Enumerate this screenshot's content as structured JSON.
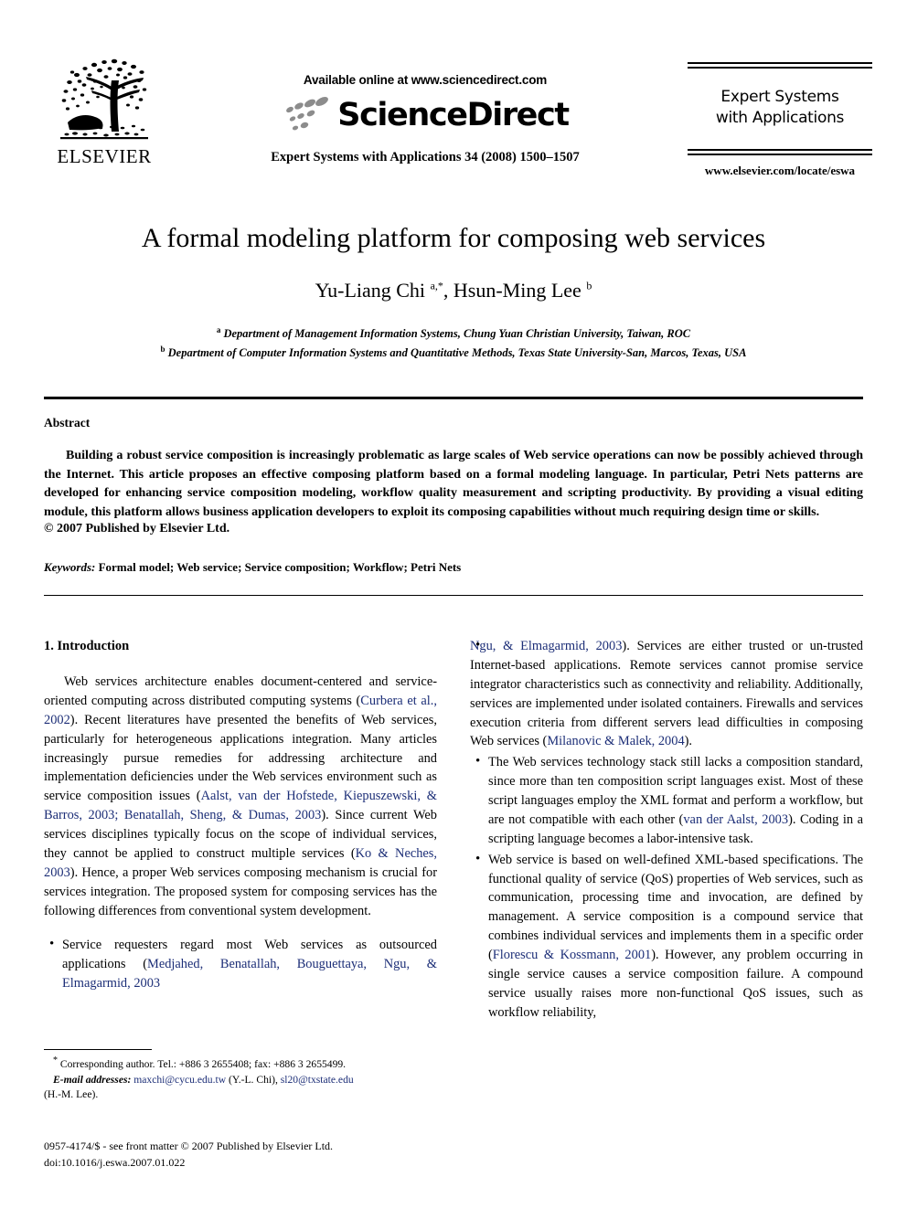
{
  "masthead": {
    "publisher": "ELSEVIER",
    "available_online": "Available online at www.sciencedirect.com",
    "sciencedirect_wordmark": "ScienceDirect",
    "journal_citation": "Expert Systems with Applications 34 (2008) 1500–1507",
    "journal_name_line1": "Expert Systems",
    "journal_name_line2": "with Applications",
    "journal_url": "www.elsevier.com/locate/eswa"
  },
  "title_block": {
    "title": "A formal modeling platform for composing web services",
    "authors": "Yu-Liang Chi ",
    "author1_sup": "a,*",
    "authors_mid": ", Hsun-Ming Lee ",
    "author2_sup": "b",
    "affiliation_a_sup": "a",
    "affiliation_a": " Department of Management Information Systems, Chung Yuan Christian University, Taiwan, ROC",
    "affiliation_b_sup": "b",
    "affiliation_b": " Department of Computer Information Systems and Quantitative Methods, Texas State University-San, Marcos, Texas, USA"
  },
  "abstract": {
    "heading": "Abstract",
    "body": "Building a robust service composition is increasingly problematic as large scales of Web service operations can now be possibly achieved through the Internet. This article proposes an effective composing platform based on a formal modeling language. In particular, Petri Nets patterns are developed for enhancing service composition modeling, workflow quality measurement and scripting productivity. By providing a visual editing module, this platform allows business application developers to exploit its composing capabilities without much requiring design time or skills.",
    "copyright": "© 2007 Published by Elsevier Ltd.",
    "keywords_label": "Keywords:",
    "keywords_value": " Formal model; Web service; Service composition; Workflow; Petri Nets"
  },
  "body": {
    "section_heading": "1. Introduction",
    "intro_p1_part1": "Web services architecture enables document-centered and service-oriented computing across distributed computing systems (",
    "intro_p1_cite1": "Curbera et al., 2002",
    "intro_p1_part2": "). Recent literatures have presented the benefits of Web services, particularly for heterogeneous applications integration. Many articles increasingly pursue remedies for addressing architecture and implementation deficiencies under the Web services environment such as service composition issues (",
    "intro_p1_cite2": "Aalst, van der Hofstede, Kiepuszewski, & Barros, 2003; Benatallah, Sheng, & Dumas, 2003",
    "intro_p1_part3": "). Since current Web services disciplines typically focus on the scope of individual services, they cannot be applied to construct multiple services (",
    "intro_p1_cite3": "Ko & Neches, 2003",
    "intro_p1_part4": "). Hence, a proper Web services composing mechanism is crucial for services integration. The proposed system for composing services has the following differences from conventional system development.",
    "bullet1_part1": "Service requesters regard most Web services as outsourced applications (",
    "bullet1_cite1": "Medjahed, Benatallah, Bouguettaya, Ngu, & Elmagarmid, 2003",
    "bullet1_part2": "). Services are either trusted or un-trusted Internet-based applications. Remote services cannot promise service integrator characteristics such as connectivity and reliability. Additionally, services are implemented under isolated containers. Firewalls and services execution criteria from different servers lead difficulties in composing Web services (",
    "bullet1_cite2": "Milanovic & Malek, 2004",
    "bullet1_part3": ").",
    "bullet2_part1": "The Web services technology stack still lacks a composition standard, since more than ten composition script languages exist. Most of these script languages employ the XML format and perform a workflow, but are not compatible with each other (",
    "bullet2_cite1": "van der Aalst, 2003",
    "bullet2_part2": "). Coding in a scripting language becomes a labor-intensive task.",
    "bullet3_part1": "Web service is based on well-defined XML-based specifications. The functional quality of service (QoS) properties of Web services, such as communication, processing time and invocation, are defined by management. A service composition is a compound service that combines individual services and implements them in a specific order (",
    "bullet3_cite1": "Florescu & Kossmann, 2001",
    "bullet3_part2": "). However, any problem occurring in single service causes a service composition failure. A compound service usually raises more non-functional QoS issues, such as workflow reliability,"
  },
  "footnote": {
    "star": "*",
    "corresponding": " Corresponding author. Tel.: +886 3 2655408; fax: +886 3 2655499.",
    "email_label": "E-mail addresses:",
    "email1": "maxchi@cycu.edu.tw",
    "email1_owner": " (Y.-L. Chi), ",
    "email2": "sl20@txstate.edu",
    "email2_owner": "(H.-M. Lee).",
    "issn_line": "0957-4174/$ - see front matter © 2007 Published by Elsevier Ltd.",
    "doi_line": "doi:10.1016/j.eswa.2007.01.022"
  },
  "colors": {
    "citation_blue": "#1c2e77",
    "swoosh_gray": "#8c8c8c",
    "text_black": "#000000"
  }
}
